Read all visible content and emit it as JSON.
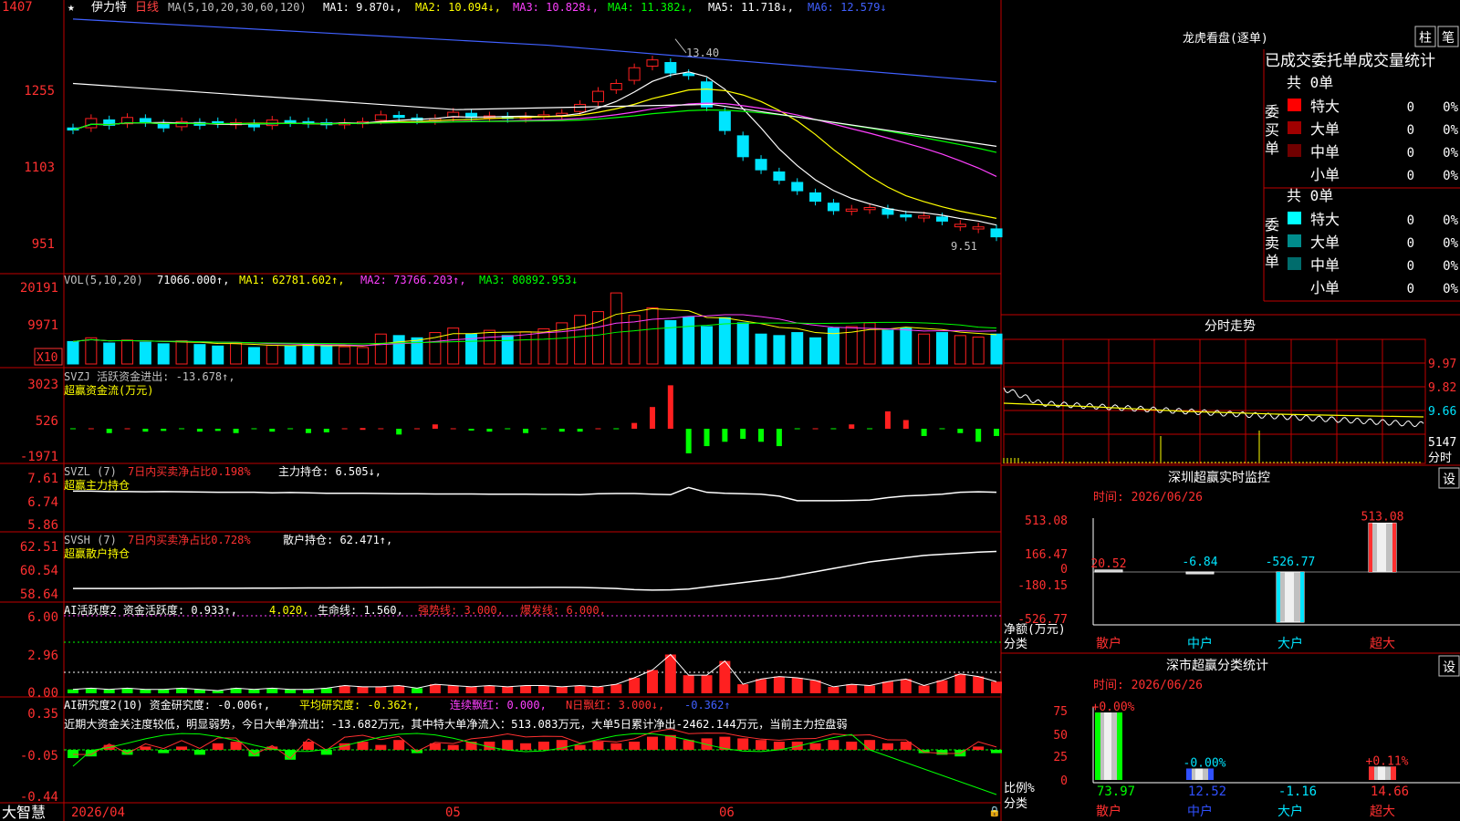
{
  "colors": {
    "up": "#ff2020",
    "down": "#00e5ff",
    "grid": "#c00000",
    "ma1": "#ffffff",
    "ma2": "#ffff00",
    "ma3": "#ff40ff",
    "ma4": "#00ff00",
    "ma5": "#ffffff",
    "ma6": "#4060ff",
    "green": "#00ff00"
  },
  "header": {
    "star": "★",
    "stock_name": "伊力特",
    "period": "日线",
    "ma_text": "MA(5,10,20,30,60,120)",
    "ma1": "MA1: 9.870↓,",
    "ma2": "MA2: 10.094↓,",
    "ma3": "MA3: 10.828↓,",
    "ma4": "MA4: 11.382↓,",
    "ma5": "MA5: 11.718↓,",
    "ma6": "MA6: 12.579↓"
  },
  "price_axis": [
    "1407",
    "1255",
    "1103",
    "951"
  ],
  "price_annotations": {
    "high": "13.40",
    "low": "9.51"
  },
  "vol_header": {
    "label": "VOL(5,10,20)",
    "value": "71066.000↑,",
    "ma1": "MA1: 62781.602↑,",
    "ma2": "MA2: 73766.203↑,",
    "ma3": "MA3: 80892.953↓"
  },
  "vol_axis": [
    "20191",
    "9971"
  ],
  "vol_unit": "X10",
  "svzj_header": {
    "label": "SVZJ  活跃资金进出: -13.678↑,",
    "sub": "超赢资金流(万元)"
  },
  "svzj_axis": [
    "3023",
    "526",
    "-1971"
  ],
  "svzl_header": {
    "label": "SVZL (7)",
    "ratio": "7日内买卖净占比0.198%",
    "hold": "主力持仓: 6.505↓,",
    "sub": "超赢主力持仓"
  },
  "svzl_axis": [
    "7.61",
    "6.74",
    "5.86"
  ],
  "svsh_header": {
    "label": "SVSH (7)",
    "ratio": "7日内买卖净占比0.728%",
    "hold": "散户持仓: 62.471↑,",
    "sub": "超赢散户持仓"
  },
  "svsh_axis": [
    "62.51",
    "60.54",
    "58.64"
  ],
  "ai1_header": {
    "label": "AI活跃度2 资金活跃度: 0.933↑,",
    "v2": "4.020,",
    "life": "生命线: 1.560,",
    "strong": "强势线: 3.000,",
    "burst": "爆发线: 6.000,"
  },
  "ai1_axis": [
    "6.00",
    "2.96",
    "0.00"
  ],
  "ai2_header": {
    "label": "AI研究度2(10) 资金研究度: -0.006↑,",
    "avg": "平均研究度: -0.362↑,",
    "red": "连续飘红: 0.000,",
    "n": "N日飘红: 3.000↓,",
    "last": "-0.362↑"
  },
  "ai2_axis": [
    "0.35",
    "-0.05",
    "-0.44"
  ],
  "ai2_text": "近期大资金关注度较低，明显弱势，今日大单净流出：-13.682万元，其中特大单净流入：513.083万元，大单5日累计净出-2462.144万元，当前主力控盘弱",
  "bottom": {
    "brand": "大智慧",
    "date": "2026/04",
    "m05": "05",
    "m06": "06"
  },
  "dragon": {
    "title": "龙虎看盘(逐单)",
    "btn1": "柱",
    "btn2": "笔",
    "subtitle": "已成交委托单成交量统计",
    "buy_label": "委买单",
    "sell_label": "委卖单",
    "buy_total": "共 0单",
    "sell_total": "共 0单",
    "buy_rows": [
      {
        "name": "特大",
        "count": "0",
        "pct": "0%",
        "color": "#ff0000"
      },
      {
        "name": "大单",
        "count": "0",
        "pct": "0%",
        "color": "#a00000"
      },
      {
        "name": "中单",
        "count": "0",
        "pct": "0%",
        "color": "#700000"
      },
      {
        "name": "小单",
        "count": "0",
        "pct": "0%",
        "color": "#000000"
      }
    ],
    "sell_rows": [
      {
        "name": "特大",
        "count": "0",
        "pct": "0%",
        "color": "#00ffff"
      },
      {
        "name": "大单",
        "count": "0",
        "pct": "0%",
        "color": "#008c8c"
      },
      {
        "name": "中单",
        "count": "0",
        "pct": "0%",
        "color": "#006c6c"
      },
      {
        "name": "小单",
        "count": "0",
        "pct": "0%",
        "color": "#000000"
      }
    ]
  },
  "intraday": {
    "title": "分时走势",
    "axis": [
      "9.97",
      "9.82",
      "9.66"
    ],
    "vol": "5147",
    "unit": "分时"
  },
  "sz_monitor": {
    "title": "深圳超赢实时监控",
    "btn": "设",
    "time": "时间: 2026/06/26",
    "ylabel": "净额(万元)",
    "xlabel_title": "分类",
    "axis": [
      "513.08",
      "166.47",
      "0",
      "-180.15",
      "-526.77"
    ],
    "categories": [
      "散户",
      "中户",
      "大户",
      "超大"
    ],
    "values": [
      20.52,
      -6.84,
      -526.77,
      513.08
    ],
    "labels": [
      "20.52",
      "-6.84",
      "-526.77",
      "513.08"
    ]
  },
  "sz_stats": {
    "title": "深市超赢分类统计",
    "btn": "设",
    "time": "时间: 2026/06/26",
    "ylabel": "比例%",
    "xlabel_title": "分类",
    "axis": [
      "75",
      "50",
      "25",
      "0"
    ],
    "categories": [
      "散户",
      "中户",
      "大户",
      "超大"
    ],
    "values": [
      73.97,
      12.52,
      -1.16,
      14.66
    ],
    "labels": [
      "73.97",
      "12.52",
      "-1.16",
      "14.66"
    ],
    "top_labels": [
      "+0.00%",
      "-0.00%",
      "",
      "+0.11%"
    ]
  },
  "chart_data": [
    {
      "type": "candlestick",
      "title": "伊力特 日线",
      "ylim": [
        9.51,
        13.4
      ],
      "x_ticks": [
        "2026/04",
        "05",
        "06"
      ],
      "series": [
        {
          "name": "MA1",
          "value": 9.87
        },
        {
          "name": "MA2",
          "value": 10.094
        },
        {
          "name": "MA3",
          "value": 10.828
        },
        {
          "name": "MA4",
          "value": 11.382
        },
        {
          "name": "MA5",
          "value": 11.718
        },
        {
          "name": "MA6",
          "value": 12.579
        }
      ],
      "close": [
        11.66,
        11.88,
        11.75,
        11.9,
        11.8,
        11.7,
        11.82,
        11.75,
        11.78,
        11.8,
        11.72,
        11.85,
        11.8,
        11.78,
        11.76,
        11.8,
        11.82,
        11.95,
        11.9,
        11.85,
        11.88,
        12.0,
        11.9,
        11.93,
        11.88,
        11.92,
        11.95,
        11.98,
        12.15,
        12.4,
        12.55,
        12.85,
        13.0,
        12.75,
        12.7,
        12.1,
        11.65,
        11.15,
        10.9,
        10.7,
        10.5,
        10.3,
        10.12,
        10.15,
        10.18,
        10.05,
        10.0,
        10.02,
        9.92,
        9.86,
        9.81,
        9.62
      ],
      "up": [
        false,
        true,
        false,
        true,
        false,
        false,
        true,
        false,
        false,
        true,
        false,
        true,
        false,
        false,
        false,
        true,
        true,
        true,
        false,
        false,
        true,
        true,
        false,
        true,
        false,
        true,
        true,
        true,
        true,
        true,
        true,
        true,
        true,
        false,
        false,
        false,
        false,
        false,
        false,
        false,
        false,
        false,
        false,
        true,
        true,
        false,
        false,
        true,
        false,
        true,
        true,
        false
      ]
    },
    {
      "type": "bar",
      "title": "VOL(5,10,20)",
      "values": [
        30,
        35,
        28,
        32,
        29,
        27,
        31,
        26,
        24,
        28,
        22,
        25,
        24,
        26,
        25,
        23,
        22,
        40,
        38,
        35,
        42,
        48,
        40,
        45,
        38,
        43,
        47,
        55,
        65,
        70,
        95,
        65,
        75,
        58,
        63,
        50,
        62,
        55,
        40,
        38,
        42,
        35,
        48,
        50,
        55,
        45,
        48,
        40,
        42,
        38,
        36,
        40
      ],
      "series": [
        {
          "name": "VOL",
          "value": 71066.0
        },
        {
          "name": "MA1",
          "value": 62781.602
        },
        {
          "name": "MA2",
          "value": 73766.203
        },
        {
          "name": "MA3",
          "value": 80892.953
        }
      ]
    },
    {
      "type": "bar",
      "title": "SVZJ 超赢资金流(万元)",
      "values": [
        0,
        0,
        -300,
        0,
        -200,
        -150,
        0,
        -200,
        -150,
        -300,
        0,
        -200,
        0,
        -300,
        -250,
        0,
        50,
        0,
        -400,
        0,
        300,
        0,
        -100,
        -200,
        0,
        -300,
        0,
        -200,
        -200,
        0,
        0,
        400,
        1500,
        3000,
        -1700,
        -1200,
        -900,
        -700,
        -900,
        -1200,
        0,
        0,
        0,
        300,
        0,
        1200,
        600,
        -500,
        0,
        -300,
        -900,
        -500
      ],
      "ylim": [
        -1971,
        3023
      ]
    },
    {
      "type": "line",
      "title": "SVZL 超赢主力持仓",
      "ylim": [
        5.86,
        7.61
      ]
    },
    {
      "type": "line",
      "title": "SVSH 超赢散户持仓",
      "ylim": [
        58.64,
        62.51
      ]
    },
    {
      "type": "bar",
      "title": "AI活跃度2",
      "ylim": [
        0,
        6
      ],
      "values": [
        0.3,
        0.4,
        0.3,
        0.4,
        0.3,
        0.3,
        0.4,
        0.3,
        0.2,
        0.4,
        0.3,
        0.4,
        0.3,
        0.3,
        0.4,
        0.6,
        0.5,
        0.5,
        0.6,
        0.4,
        0.7,
        0.6,
        0.5,
        0.6,
        0.5,
        0.6,
        0.6,
        0.5,
        0.6,
        0.5,
        0.7,
        1.2,
        1.8,
        3.0,
        1.4,
        1.4,
        2.5,
        0.7,
        1.1,
        1.3,
        1.2,
        1.0,
        0.5,
        0.7,
        0.6,
        0.9,
        1.1,
        0.6,
        1.0,
        1.5,
        1.3,
        0.9
      ]
    },
    {
      "type": "bar",
      "title": "AI研究度2(10)",
      "ylim": [
        -0.44,
        0.35
      ]
    }
  ]
}
